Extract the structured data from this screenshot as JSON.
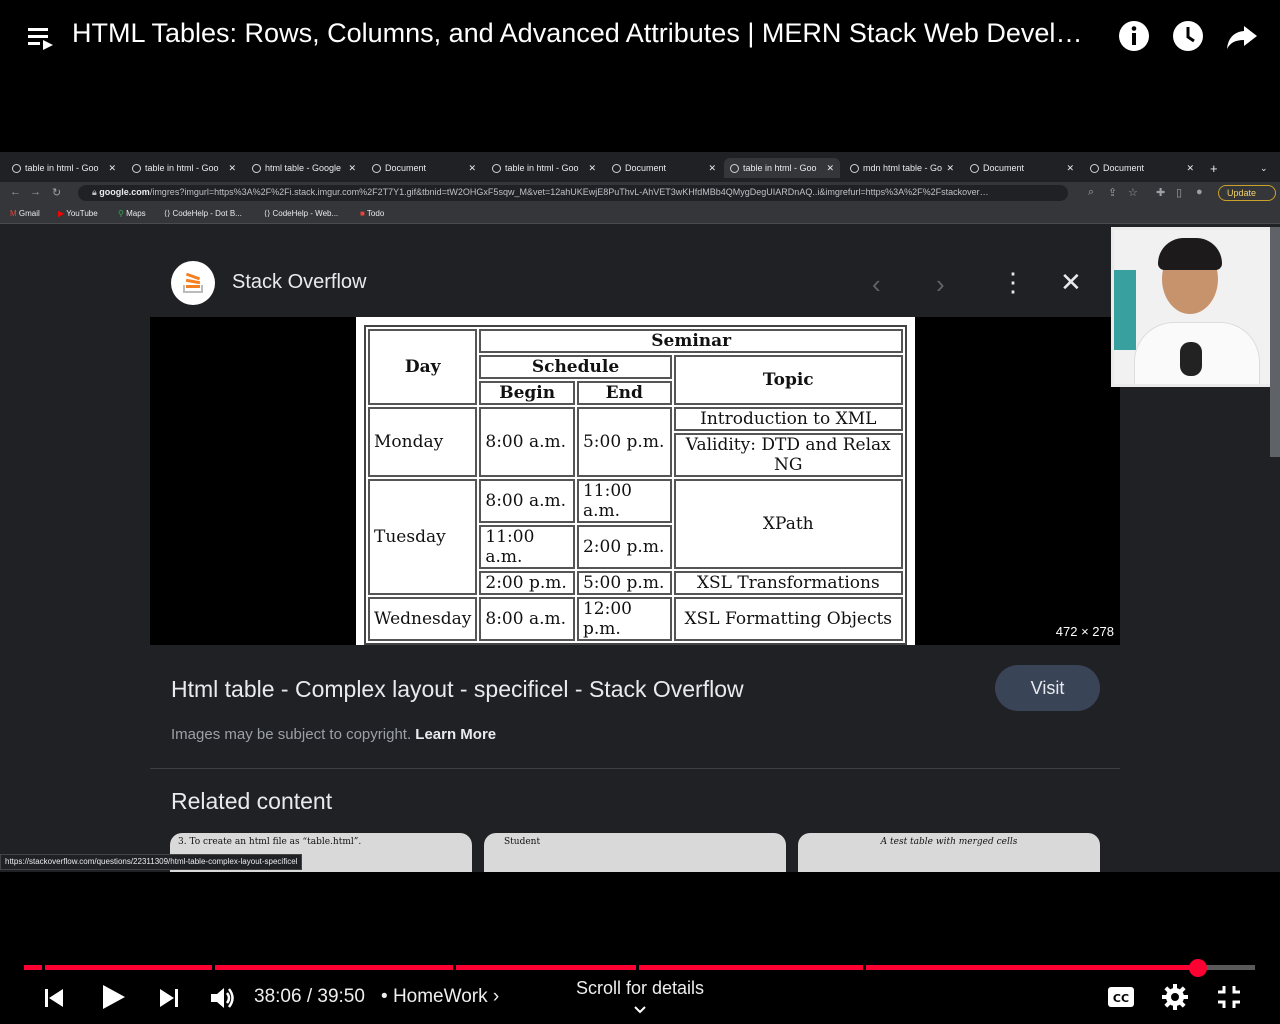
{
  "player": {
    "title": "HTML Tables: Rows, Columns, and Advanced Attributes | MERN Stack Web Develop…",
    "time": "38:06 / 39:50",
    "chapter_separator": "•",
    "chapter": "HomeWork",
    "chapter_chevron": "›",
    "scroll_details": "Scroll for details",
    "progress_fraction": 0.954,
    "accent": "#ff0033"
  },
  "browser": {
    "tabs": [
      {
        "label": "table in html - Goo"
      },
      {
        "label": "table in html - Goo"
      },
      {
        "label": "html table - Google"
      },
      {
        "label": "Document"
      },
      {
        "label": "table in html - Goo"
      },
      {
        "label": "Document"
      },
      {
        "label": "table in html - Goo"
      },
      {
        "label": "mdn html table - Go"
      },
      {
        "label": "Document"
      },
      {
        "label": "Document"
      }
    ],
    "new_tab": "+",
    "url_domain": "google.com",
    "url_rest": "/imgres?imgurl=https%3A%2F%2Fi.stack.imgur.com%2F2T7Y1.gif&tbnid=tW2OHGxF5sqw_M&vet=12ahUKEwjE8PuThvL-AhVET3wKHfdMBb4QMygDegUIARDnAQ..i&imgrefurl=https%3A%2F%2Fstackover…",
    "update_label": "Update",
    "bookmarks": [
      {
        "label": "Gmail"
      },
      {
        "label": "YouTube"
      },
      {
        "label": "Maps"
      },
      {
        "label": "CodeHelp - Dot B..."
      },
      {
        "label": "CodeHelp - Web..."
      },
      {
        "label": "Todo"
      }
    ],
    "status_url": "https://stackoverflow.com/questions/22311309/html-table-complex-layout-specificel"
  },
  "lens": {
    "source_name": "Stack Overflow",
    "image_dims": "472 × 278",
    "result_title": "Html table - Complex layout - specificel - Stack Overflow",
    "visit_label": "Visit",
    "copyright": "Images may be subject to copyright.",
    "learn_more": "Learn More",
    "related_heading": "Related content",
    "thumbs": [
      {
        "text": "3. To create an html file as “table.html”."
      },
      {
        "text": "Student"
      },
      {
        "text": "A test table with merged cells"
      }
    ]
  },
  "seminar_table": {
    "seminar": "Seminar",
    "day": "Day",
    "schedule": "Schedule",
    "topic": "Topic",
    "begin": "Begin",
    "end": "End",
    "monday": "Monday",
    "tuesday": "Tuesday",
    "wednesday": "Wednesday",
    "mon_begin": "8:00 a.m.",
    "mon_end": "5:00 p.m.",
    "mon_topic1": "Introduction to XML",
    "mon_topic2": "Validity: DTD and Relax NG",
    "tue_b1": "8:00 a.m.",
    "tue_e1": "11:00 a.m.",
    "tue_b2": "11:00 a.m.",
    "tue_e2": "2:00 p.m.",
    "tue_b3": "2:00 p.m.",
    "tue_e3": "5:00 p.m.",
    "tue_topic1": "XPath",
    "tue_topic2": "XSL Transformations",
    "wed_begin": "8:00 a.m.",
    "wed_end": "12:00 p.m.",
    "wed_topic": "XSL Formatting Objects"
  }
}
